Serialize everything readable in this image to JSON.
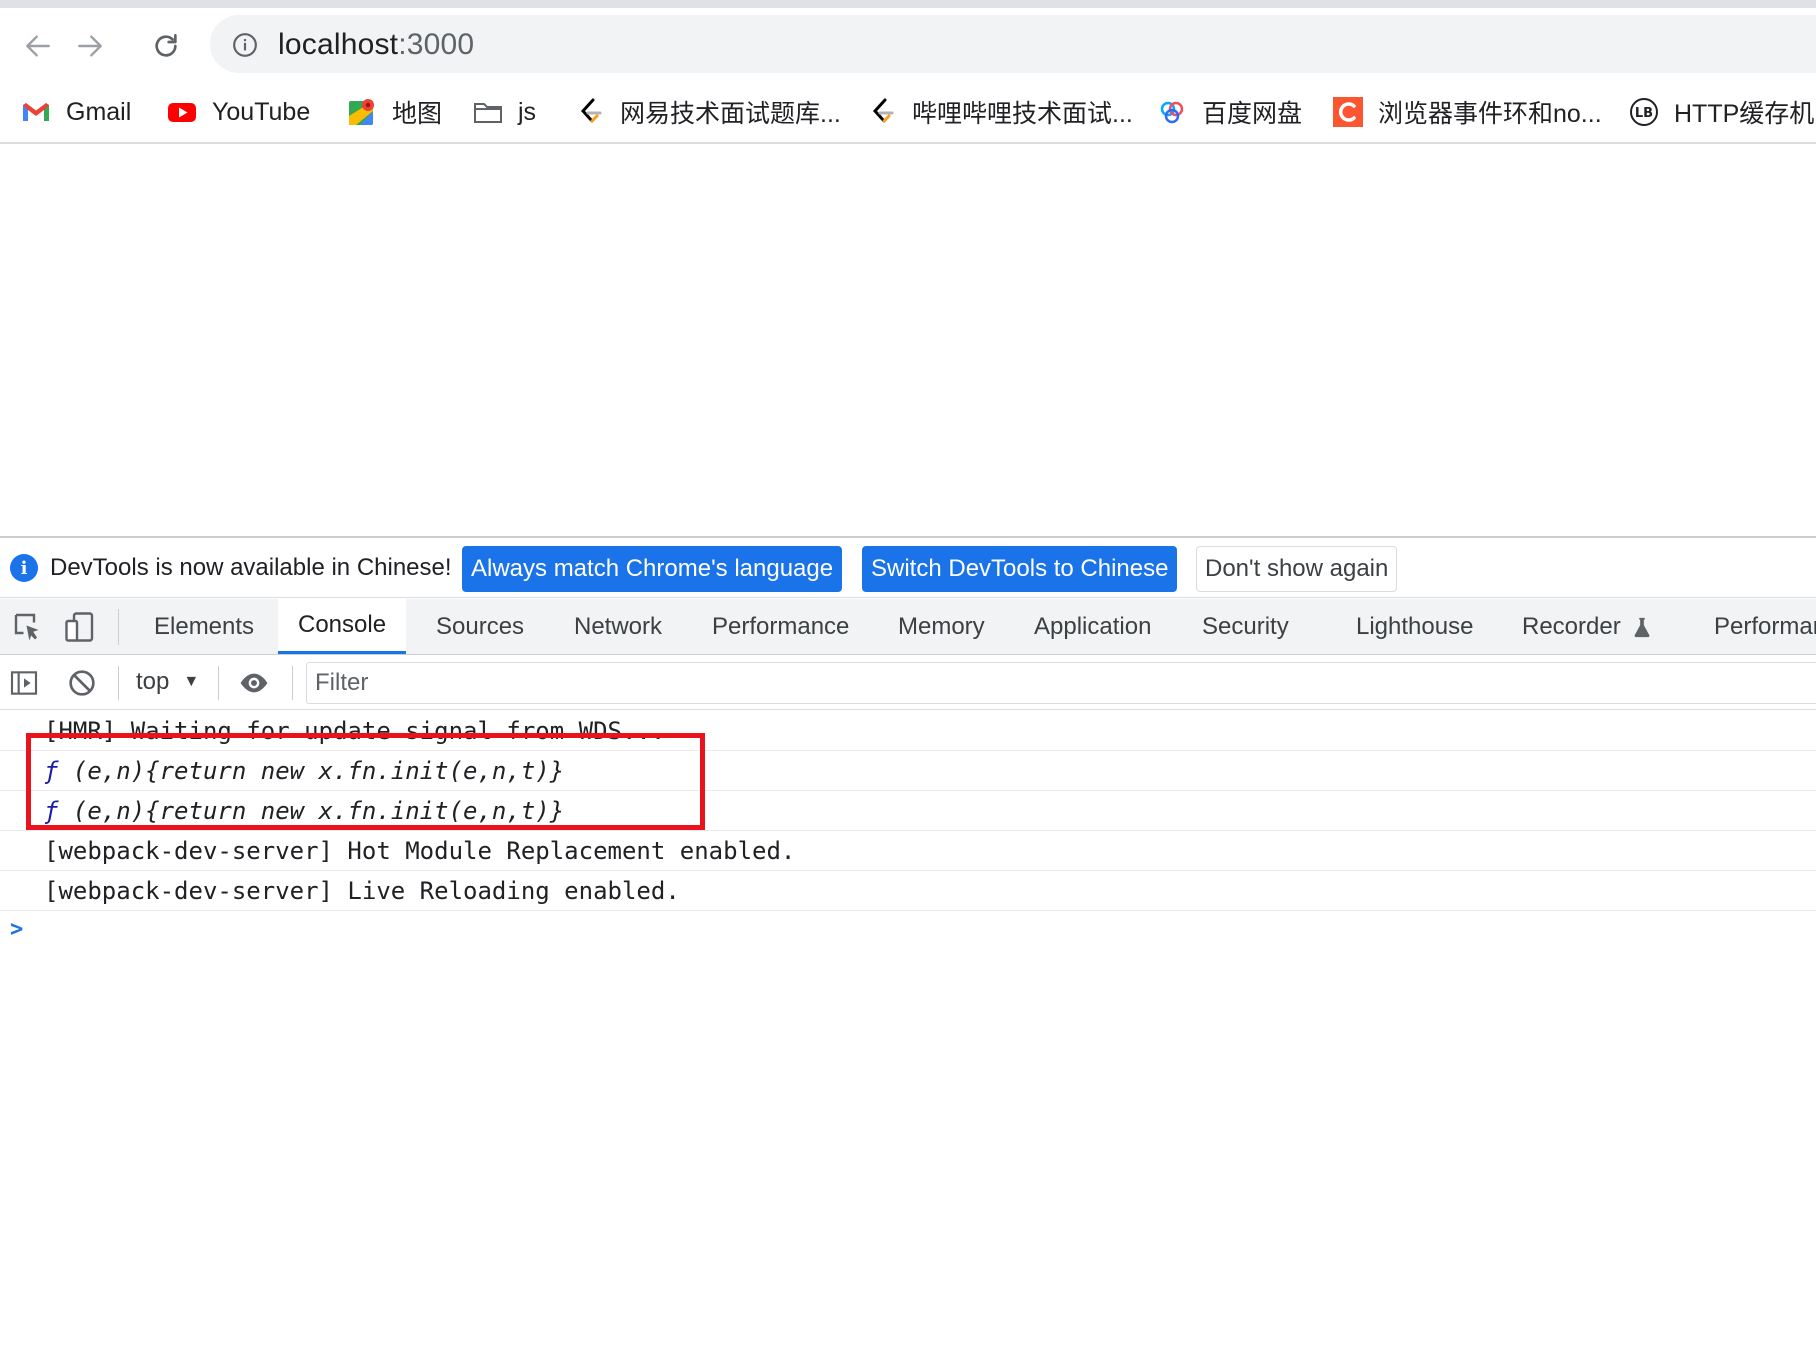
{
  "browser": {
    "url_host": "localhost",
    "url_port": ":3000",
    "bookmarks": [
      {
        "label": "Gmail",
        "icon": "gmail-icon"
      },
      {
        "label": "YouTube",
        "icon": "youtube-icon"
      },
      {
        "label": "地图",
        "icon": "maps-icon"
      },
      {
        "label": "js",
        "icon": "folder-icon"
      },
      {
        "label": "网易技术面试题库...",
        "icon": "leetcode-icon"
      },
      {
        "label": "哔哩哔哩技术面试...",
        "icon": "leetcode-icon"
      },
      {
        "label": "百度网盘",
        "icon": "baidu-pan-icon"
      },
      {
        "label": "浏览器事件环和no...",
        "icon": "csdn-icon"
      },
      {
        "label": "HTTP缓存机",
        "icon": "lb-icon"
      }
    ]
  },
  "devtools": {
    "infobar": {
      "message": "DevTools is now available in Chinese!",
      "btn_always_match": "Always match Chrome's language",
      "btn_switch": "Switch DevTools to Chinese",
      "btn_dont_show": "Don't show again"
    },
    "tabs": [
      "Elements",
      "Console",
      "Sources",
      "Network",
      "Performance",
      "Memory",
      "Application",
      "Security",
      "Lighthouse",
      "Recorder",
      "Performar"
    ],
    "active_tab": "Console",
    "console": {
      "context": "top",
      "filter_placeholder": "Filter",
      "logs": [
        {
          "type": "text",
          "text": "[HMR] Waiting for update signal from WDS..."
        },
        {
          "type": "function",
          "prefix": "ƒ",
          "text": " (e,n){return new x.fn.init(e,n,t)}"
        },
        {
          "type": "function",
          "prefix": "ƒ",
          "text": " (e,n){return new x.fn.init(e,n,t)}"
        },
        {
          "type": "text",
          "text": "[webpack-dev-server] Hot Module Replacement enabled."
        },
        {
          "type": "text",
          "text": "[webpack-dev-server] Live Reloading enabled."
        }
      ],
      "prompt_symbol": ">"
    }
  },
  "colors": {
    "accent": "#1a73e8",
    "highlight": "#e8131c"
  }
}
